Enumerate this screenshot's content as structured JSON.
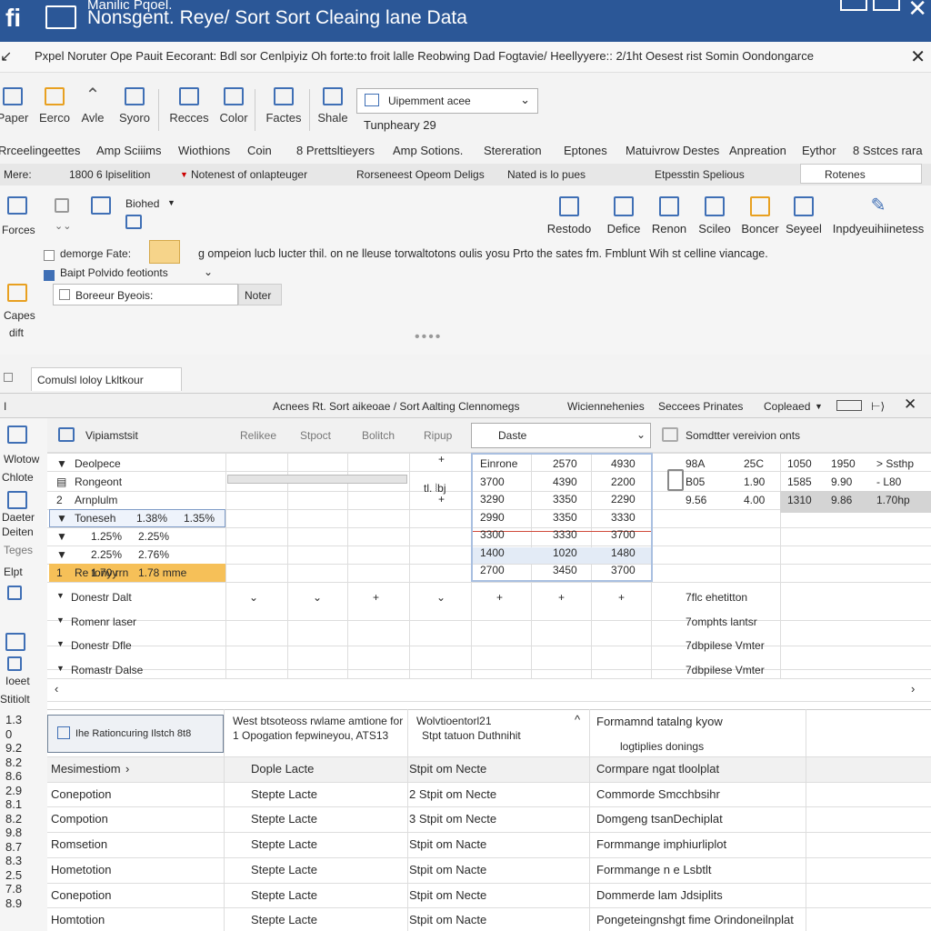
{
  "titlebar": {
    "line1": "Manilic Pqoel.",
    "line2": "Nonsgent. Reye/ Sort Sort Cleaing lane Data"
  },
  "infobar": {
    "text": "Pxpel Noruter Ope Pauit Eecorant: Bdl sor Cenlpiyiz Oh forte:to froit lalle Reobwing Dad Fogtavie/ Heellyyere:: 2/1ht Oesest rist Somin Oondongarce"
  },
  "ribbon": {
    "buttons": [
      "Paper",
      "Eerco",
      "Avle",
      "Syoro",
      "Recces",
      "Color",
      "Factes",
      "Shale"
    ],
    "dropdown": "Uipemment acee",
    "date_label": "Tunpheary 29"
  },
  "menu": [
    "Rrceelingeettes",
    "Amp Sciiims",
    "Wiothions",
    "Coin",
    "8 Prettsltieyers",
    "Amp Sotions.",
    "Stereration",
    "Eptones",
    "Matuivrow Destes",
    "Anpreation",
    "Eythor",
    "8 Sstces rara"
  ],
  "filters": {
    "label": "Mere:",
    "items": [
      "1800 6 lpiselition",
      "Notenest of onlapteuger",
      "Rorseneest Opeom Deligs",
      "Nated is lo pues",
      "Etpesstin Spelious"
    ],
    "box": "Rotenes"
  },
  "options": {
    "forces_label": "Forces",
    "header": "Biohed",
    "right_buttons": [
      "Restodo",
      "Defice",
      "Renon",
      "Scileo",
      "Boncer",
      "Seyeel",
      "Inpdyeuihiinetess"
    ],
    "check1": "demorge Fate:",
    "check1_desc": "g ompeion lucb lucter thil. on ne lleuse torwaltotons oulis yosu Prto the sates fm. Fmblunt Wih st celline viancage.",
    "check2": "Baipt Polvido feotionts",
    "capes": "Capes",
    "diff": "dift",
    "input": "Boreeur Byeois:",
    "input_btn": "Noter"
  },
  "tab": "Comulsl loloy Lkltkour",
  "sheethead": {
    "left": "I",
    "title": "Acnees Rt. Sort aikeoae / Sort Aalting Clennomegs",
    "r1": "Wiciennehenies",
    "r2": "Seccees Prinates",
    "r3": "Copleaed"
  },
  "sidebar": [
    "Wlotow",
    "Chlote",
    "Daeter",
    "Deiten",
    "Teges",
    "Elpt",
    "Ioeet",
    "Stitiolt"
  ],
  "grid": {
    "h1": "Vipiamstsit",
    "h2": "Relikee",
    "h3": "Stpoct",
    "h4": "Bolitch",
    "h5": "Ripup",
    "h6": "Daste",
    "h7": "Somdtter vereivion onts",
    "tree": [
      "Deolpece",
      "Rongeont",
      "Arnplulm",
      "Toneseh",
      "",
      "",
      "Re tonyy"
    ],
    "pct1": [
      "",
      "",
      "",
      "1.38%",
      "1.25%",
      "2.25%",
      "1.70 rrn"
    ],
    "pct2": [
      "",
      "",
      "",
      "1.35%",
      "2.25%",
      "2.76%",
      "1.78 mme"
    ],
    "numA": [
      "Einrone",
      "3700",
      "3290",
      "2990",
      "3300",
      "1400",
      "2700"
    ],
    "numB": [
      "2570",
      "4390",
      "3350",
      "3350",
      "3330",
      "1020",
      "3450"
    ],
    "numC": [
      "4930",
      "2200",
      "2290",
      "3330",
      "3700",
      "1480",
      "3700"
    ],
    "right1": [
      "98A",
      "B05",
      "9.56"
    ],
    "right2": [
      "25C",
      "1.90",
      "4.00"
    ],
    "right3": [
      "1050",
      "1585",
      "1310"
    ],
    "right4": [
      "1950",
      "9.90",
      "9.86"
    ],
    "right5": [
      "> Ssthp",
      "- L80",
      "1.70hp"
    ],
    "lower": [
      "Donestr Dalt",
      "Romenr laser",
      "Donestr Dfle",
      "Romastr Dalse"
    ],
    "lower_right": [
      "7flc ehetitton",
      "7omphts lantsr",
      "7dbpilese Vmter",
      "7dbpilese Vmter"
    ]
  },
  "btable": {
    "btn": "Ihe Rationcuring Ilstch 8t8",
    "c2a": "West btsoteoss rwlame amtione for",
    "c2b": "1 Opogation fepwineyou, ATS13",
    "c3a": "Wolvtioentorl21",
    "c3b": "Stpt tatuon Duthnihit",
    "c4a": "Formamnd tatalng kyow",
    "c4b": "logtiplies donings",
    "rownums": [
      "1.3",
      "0",
      "9.2",
      "8.2",
      "8.6",
      "2.9",
      "8.1",
      "8.2",
      "9.8",
      "8.7",
      "8.3",
      "2.5",
      "7.8",
      "8.9"
    ],
    "rows": [
      [
        "Mesimestiom",
        "Dople Lacte",
        "Stpit om Necte",
        "Cormpare ngat tloolplat"
      ],
      [
        "Conepotion",
        "Stepte Lacte",
        "2 Stpit om Necte",
        "Commorde Smcchbsihr"
      ],
      [
        "Compotion",
        "Stepte Lacte",
        "3 Stpit om Necte",
        "Domgeng tsanDechiplat"
      ],
      [
        "Romsetion",
        "Stepte Lacte",
        "Stpit om Nacte",
        "Formmange imphiurliplot"
      ],
      [
        "Hometotion",
        "Stepte Lacte",
        "Stpit om Nacte",
        "Formmange n e Lsbtlt"
      ],
      [
        "Conepotion",
        "Stepte Lacte",
        "Stpit om Necte",
        "Dommerde lam Jdsiplits"
      ],
      [
        "Homtotion",
        "Stepte Lacte",
        "Stpit om Nacte",
        "Pongeteingnshgt fime Orindoneilnplat"
      ]
    ]
  }
}
